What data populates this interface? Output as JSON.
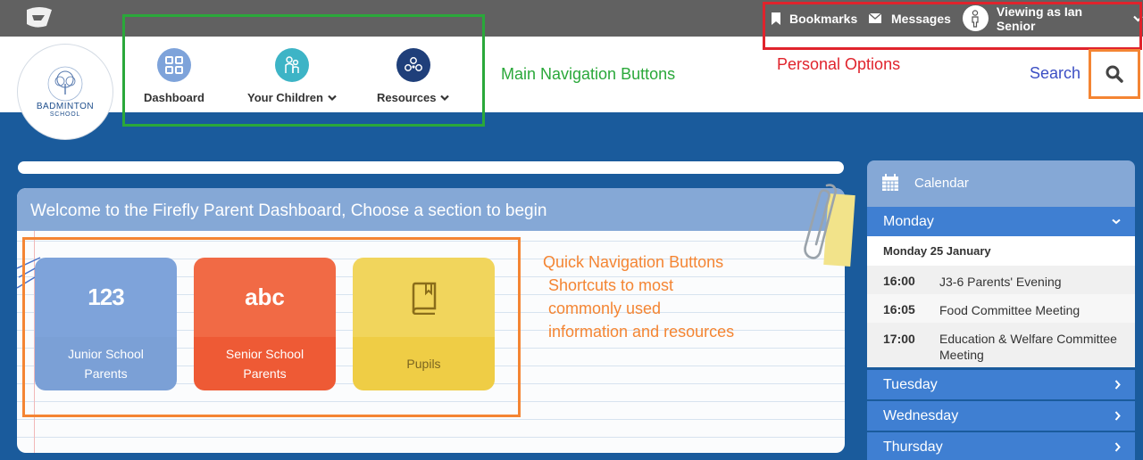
{
  "topbar": {
    "bookmarks_label": "Bookmarks",
    "messages_label": "Messages",
    "viewing_label": "Viewing as Ian Senior"
  },
  "school": {
    "name_line1": "BADMINTON",
    "name_line2": "SCHOOL"
  },
  "nav": {
    "dashboard_label": "Dashboard",
    "children_label": "Your Children",
    "resources_label": "Resources"
  },
  "annotations": {
    "main_nav": "Main Navigation Buttons",
    "personal": "Personal Options",
    "search": "Search",
    "quick_nav_title": "Quick Navigation Buttons",
    "quick_nav_desc": [
      "Shortcuts to most",
      "commonly used",
      "information and resources"
    ]
  },
  "welcome": {
    "title": "Welcome to the Firefly Parent Dashboard, Choose a section to begin"
  },
  "tiles": [
    {
      "icon_text": "123",
      "label_line1": "Junior School",
      "label_line2": "Parents"
    },
    {
      "icon_text": "abc",
      "label_line1": "Senior School",
      "label_line2": "Parents"
    },
    {
      "icon": "book-icon",
      "label_line1": "Pupils",
      "label_line2": ""
    }
  ],
  "calendar": {
    "title": "Calendar",
    "days": [
      "Monday",
      "Tuesday",
      "Wednesday",
      "Thursday"
    ],
    "date_heading": "Monday 25 January",
    "events": [
      {
        "time": "16:00",
        "title": "J3-6 Parents' Evening"
      },
      {
        "time": "16:05",
        "title": "Food Committee Meeting"
      },
      {
        "time": "17:00",
        "title": "Education & Welfare Committee Meeting"
      }
    ]
  },
  "colors": {
    "nav_dashboard": "#7ea3da",
    "nav_children": "#3db4c6",
    "nav_resources": "#1f3f7a",
    "annot_green": "#2aa83a",
    "annot_red": "#e0232c",
    "annot_orange": "#f48533",
    "annot_blue": "#3c4fc4"
  }
}
